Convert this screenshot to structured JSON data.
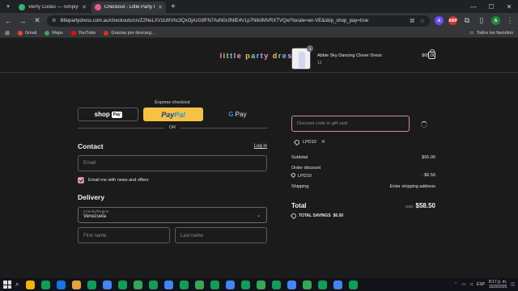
{
  "browser": {
    "tabs": [
      {
        "label": "Verify Codes — SimplyCodes",
        "color": "#2bb673",
        "active": false
      },
      {
        "label": "Checkout - Little Party Dress",
        "color": "#e55b8b",
        "active": true
      }
    ],
    "new_tab_glyph": "+",
    "url": "littlepartydress.com.au/checkouts/cn/Z2NeLXVzLWVhc3QxOjAzG8FN7AxN0c0NlE4V1p7Nlk0MVRXTVQw?locale=en-VE&skip_shop_pay=true",
    "bookmarks": [
      {
        "label": "Gmail",
        "color": "#ea4335"
      },
      {
        "label": "Maps",
        "color": "#34a853"
      },
      {
        "label": "YouTube",
        "color": "#ff0000"
      },
      {
        "label": "Gracias por descarg...",
        "color": "#d93025"
      }
    ],
    "bookmarks_right": "Todos los favoritos",
    "extensions": [
      {
        "label": "A",
        "color": "#6a4cff"
      },
      {
        "label": "ABP",
        "color": "#d32f2f"
      },
      {
        "label": "A",
        "color": "#1a8c3c"
      }
    ]
  },
  "site": {
    "logo_letters": [
      {
        "ch": "l",
        "color": "#f29bb0"
      },
      {
        "ch": "i",
        "color": "#f6c35a"
      },
      {
        "ch": "t",
        "color": "#8fd0b0"
      },
      {
        "ch": "t",
        "color": "#8cb6f0"
      },
      {
        "ch": "l",
        "color": "#c9a2ef"
      },
      {
        "ch": "e",
        "color": "#f29bb0"
      },
      {
        "ch": " ",
        "color": "#ffffff"
      },
      {
        "ch": "p",
        "color": "#f6c35a"
      },
      {
        "ch": "a",
        "color": "#8fd0b0"
      },
      {
        "ch": "r",
        "color": "#8cb6f0"
      },
      {
        "ch": "t",
        "color": "#c9a2ef"
      },
      {
        "ch": "y",
        "color": "#f29bb0"
      },
      {
        "ch": " ",
        "color": "#ffffff"
      },
      {
        "ch": "d",
        "color": "#f6c35a"
      },
      {
        "ch": "r",
        "color": "#8fd0b0"
      },
      {
        "ch": "e",
        "color": "#8cb6f0"
      },
      {
        "ch": "s",
        "color": "#c9a2ef"
      },
      {
        "ch": "s",
        "color": "#f29bb0"
      }
    ]
  },
  "checkout": {
    "express_title": "Express checkout",
    "shop_pay": {
      "label": "shop",
      "badge": "Pay"
    },
    "paypal": {
      "pay": "Pay",
      "pal": "Pal"
    },
    "gpay": {
      "g": "G",
      "label": "Pay"
    },
    "or_label": "OR",
    "contact": {
      "title": "Contact",
      "login_label": "Log in",
      "email_placeholder": "Email",
      "news_label": "Email me with news and offers"
    },
    "delivery": {
      "title": "Delivery",
      "country_label": "Country/Region",
      "country_value": "Venezuela",
      "first_name_placeholder": "First name",
      "last_name_placeholder": "Last name"
    }
  },
  "summary": {
    "product": {
      "name": "Abbie Sky Dancing Clover Dress",
      "variant": "12",
      "price": "$65.00",
      "qty": "1"
    },
    "discount_placeholder": "Discount code or gift card",
    "applied_code": "LPD10",
    "subtotal_label": "Subtotal",
    "subtotal_value": "$65.00",
    "order_discount_label": "Order discount",
    "discount_code": "LPD10",
    "discount_value": "- $6.50",
    "shipping_label": "Shipping",
    "shipping_value": "Enter shipping address",
    "total_label": "Total",
    "total_currency": "USD",
    "total_value": "$58.50",
    "savings_label": "TOTAL SAVINGS",
    "savings_value": "$6.50"
  },
  "taskbar": {
    "app_colors": [
      "#f4b400",
      "#0f9d58",
      "#1a73e8",
      "#e8a33b",
      "#0f9d58",
      "#4285f4",
      "#0f9d58",
      "#34a853",
      "#0f9d58",
      "#4285f4",
      "#0f9d58",
      "#34a853",
      "#0f9d58",
      "#4285f4",
      "#0f9d58",
      "#34a853",
      "#0f9d58",
      "#4285f4",
      "#34a853",
      "#0f9d58",
      "#4285f4",
      "#0f9d58"
    ],
    "lang": "ESP",
    "time": "8:17 p. m.",
    "date": "15/3/2025"
  }
}
